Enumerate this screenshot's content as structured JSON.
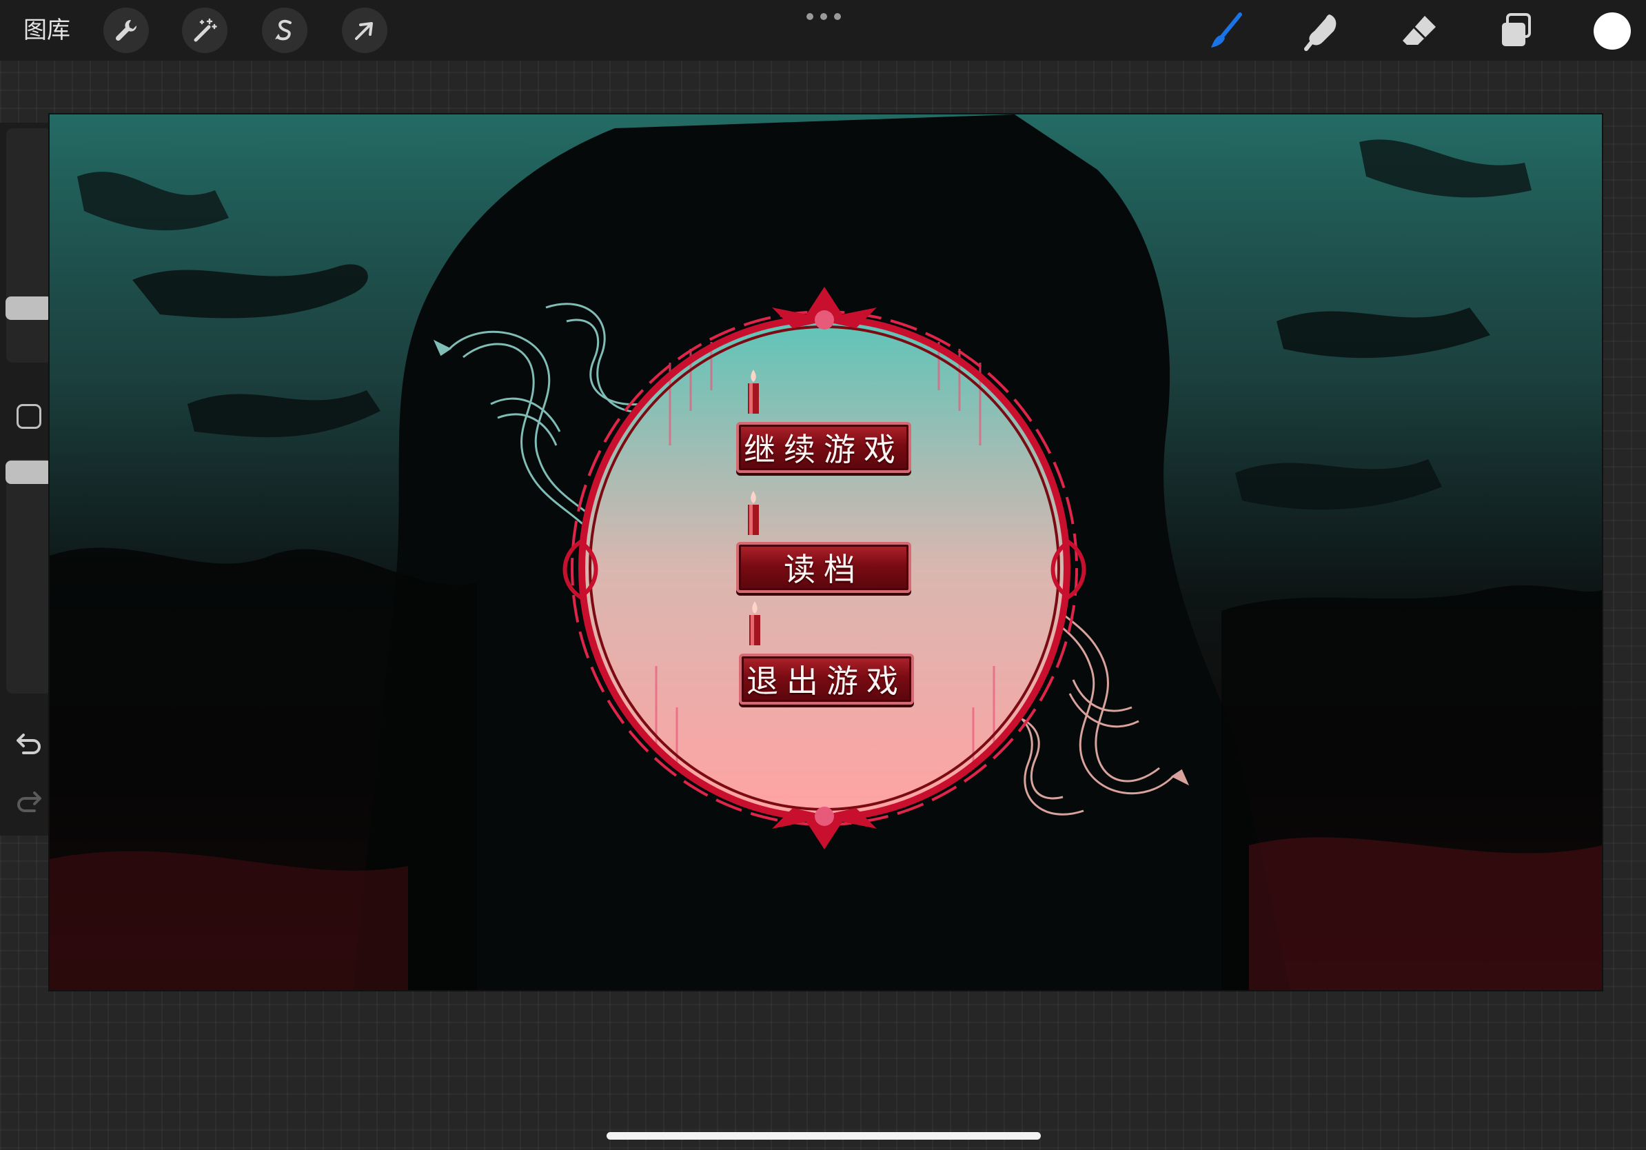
{
  "topbar": {
    "gallery_label": "图库",
    "left_tools": [
      {
        "name": "actions",
        "icon": "wrench-icon"
      },
      {
        "name": "adjustments",
        "icon": "magic-wand-icon"
      },
      {
        "name": "selection",
        "icon": "selection-s-icon"
      },
      {
        "name": "transform",
        "icon": "arrow-cursor-icon"
      }
    ],
    "more_icon": "more-dots-icon",
    "right_tools": [
      {
        "name": "brush",
        "icon": "brush-icon",
        "active": true
      },
      {
        "name": "smudge",
        "icon": "smudge-finger-icon"
      },
      {
        "name": "eraser",
        "icon": "eraser-icon"
      },
      {
        "name": "layers",
        "icon": "layers-icon"
      }
    ],
    "current_color": "#ffffff",
    "active_tool_color": "#1a74e8"
  },
  "sidebar": {
    "brush_size_icon": "brush-size-slider",
    "modify_icon": "square-modify-icon",
    "opacity_icon": "opacity-slider",
    "undo_icon": "undo-icon",
    "redo_icon": "redo-icon"
  },
  "canvas": {
    "menu": {
      "continue_label": "继续游戏",
      "load_label": "读档",
      "quit_label": "退出游戏"
    },
    "colors": {
      "frame_red": "#c8102e",
      "button_red": "#7a0b13",
      "sky_top": "#5fc4b8",
      "sky_bottom": "#ffa3a3"
    }
  }
}
